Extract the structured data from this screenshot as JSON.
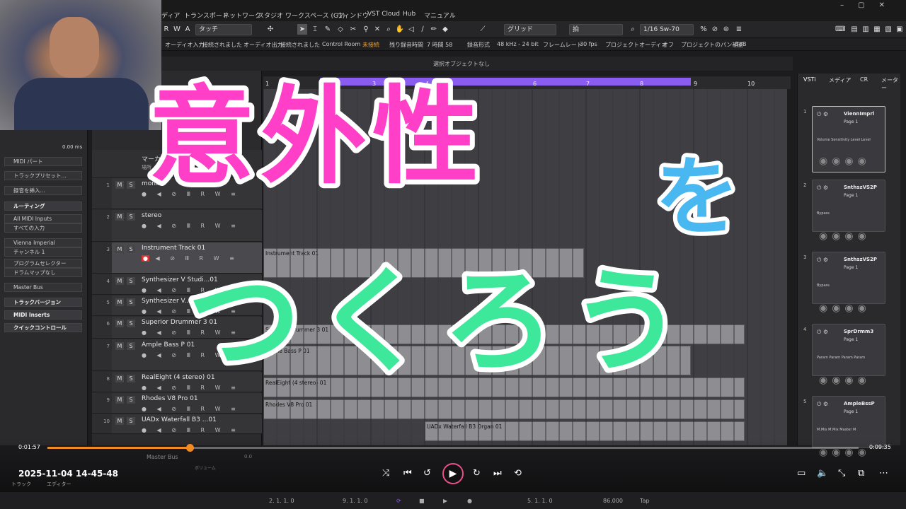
{
  "menu": [
    "ディア",
    "トランスポート",
    "ネットワーク",
    "スタジオ",
    "ワークスペース (G1)",
    "ウィンドウ",
    "VST Cloud",
    "Hub",
    "マニュアル"
  ],
  "toolbar": {
    "mode": "タッチ",
    "grid": "グリッド",
    "snap_type": "拍",
    "quantize": "1/16 Sw-70"
  },
  "status": {
    "audio_in": "オーディオ入力",
    "connected1": "接続されました",
    "audio_out": "オーディオ出力",
    "connected2": "接続されました",
    "control_room": "Control Room",
    "disconnected": "未接続",
    "rec_time_label": "残り録音時間",
    "rec_time": "7 時間 58",
    "rec_format": "録音形式",
    "bit": "48 kHz - 24 bit",
    "frame_label": "フレームレート",
    "fps": "30 fps",
    "pan_label": "プロジェクトオーディオ",
    "off": "オフ",
    "pan_law": "プロジェクトのパン補正",
    "db": "-3dB"
  },
  "infobar": "選択オブジェクトなし",
  "inspector": {
    "time": "0.00 ms",
    "midi_part": "MIDI パート",
    "preset": "トラックプリセット...",
    "insert": "録音を挿入...",
    "routing": "ルーティング",
    "midi_in": "All MIDI Inputs",
    "all_in": "すべての入力",
    "instrument": "Vienna Imperial",
    "channel": "チャンネル 1",
    "prog": "プログラムセレクター",
    "drummap": "ドラムマップなし",
    "bus": "Master Bus",
    "track_versions": "トラックバージョン",
    "midi_inserts": "MIDI Inserts",
    "quick_controls": "クイックコントロール"
  },
  "marker": {
    "label": "マーカー",
    "sub": "場所"
  },
  "tracks": [
    {
      "num": "1",
      "name": "mono"
    },
    {
      "num": "2",
      "name": "stereo"
    },
    {
      "num": "3",
      "name": "Instrument Track 01"
    },
    {
      "num": "4",
      "name": "Synthesizer V Studi...01"
    },
    {
      "num": "5",
      "name": "Synthesizer V..."
    },
    {
      "num": "6",
      "name": "Superior Drummer 3 01"
    },
    {
      "num": "7",
      "name": "Ample Bass P 01"
    },
    {
      "num": "8",
      "name": "RealEight (4 stereo) 01"
    },
    {
      "num": "9",
      "name": "Rhodes V8 Pro 01"
    },
    {
      "num": "10",
      "name": "UADx Waterfall B3 ...01"
    }
  ],
  "master": {
    "name": "Master Bus",
    "vol": "ボリューム",
    "db": "0.0"
  },
  "ruler": [
    "1",
    "3",
    "4",
    "6",
    "7",
    "8",
    "9",
    "10"
  ],
  "events": {
    "inst": "Instrument Track 01",
    "drum": "Superior Drummer 3 01",
    "bass": "Ample Bass P 01",
    "real": "RealEight (4 stereo) 01",
    "rhodes": "Rhodes V8 Pro 01",
    "uad": "UADx Waterfall B3 Organ 01"
  },
  "rack": {
    "tabs": [
      "VSTi",
      "メディア",
      "CR",
      "メーター"
    ],
    "slots": [
      {
        "num": "1",
        "name": "ViennImprl",
        "page": "Page 1",
        "params": "Volume  Sensitivity  Level  Level"
      },
      {
        "num": "2",
        "name": "SnthszVS2P",
        "page": "Page 1",
        "params": "Bypass"
      },
      {
        "num": "3",
        "name": "SnthszVS2P",
        "page": "Page 1",
        "params": "Bypass"
      },
      {
        "num": "4",
        "name": "SprDrmm3",
        "page": "Page 1",
        "params": "Param  Param  Param  Param"
      },
      {
        "num": "5",
        "name": "AmpleBssP",
        "page": "Page 1",
        "params": "M.Mix  M.Mix  Master  M"
      }
    ]
  },
  "overlay": {
    "line1": "意外性",
    "line2": "を",
    "line3": "つくろう"
  },
  "video": {
    "current": "0:01:57",
    "total": "0:09:35",
    "stamp": "2025-11-04 14-45-48",
    "progress": 0.175
  },
  "bottom_tabs": {
    "track": "トラック",
    "editor": "エディター"
  },
  "transport": {
    "pos1": "2. 1. 1.  0",
    "pos2": "9. 1. 1.  0",
    "pos3": "5. 1. 1.  0",
    "tempo": "86.000",
    "tap": "Tap"
  },
  "colors": {
    "loop": "#8a5cf0",
    "progress": "#f08a24",
    "title_pink": "#ff3fc8",
    "title_blue": "#49b8f0",
    "title_green": "#3ee89a"
  }
}
